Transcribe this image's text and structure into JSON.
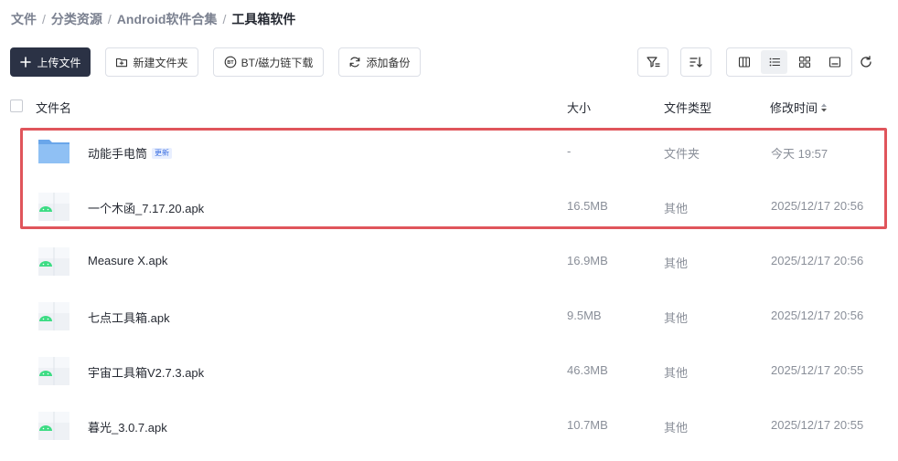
{
  "breadcrumb": {
    "items": [
      "文件",
      "分类资源",
      "Android软件合集",
      "工具箱软件"
    ],
    "separator": "/"
  },
  "toolbar": {
    "upload_label": "上传文件",
    "new_folder_label": "新建文件夹",
    "bt_label": "BT/磁力链下载",
    "backup_label": "添加备份"
  },
  "table": {
    "headers": {
      "name": "文件名",
      "size": "大小",
      "type": "文件类型",
      "modified": "修改时间"
    },
    "rows": [
      {
        "name": "动能手电筒",
        "badge": "更新",
        "size": "-",
        "type": "文件夹",
        "modified": "今天 19:57",
        "kind": "folder"
      },
      {
        "name": "一个木函_7.17.20.apk",
        "size": "16.5MB",
        "type": "其他",
        "modified": "2025/12/17 20:56",
        "kind": "apk"
      },
      {
        "name": "Measure X.apk",
        "size": "16.9MB",
        "type": "其他",
        "modified": "2025/12/17 20:56",
        "kind": "apk"
      },
      {
        "name": "七点工具箱.apk",
        "size": "9.5MB",
        "type": "其他",
        "modified": "2025/12/17 20:56",
        "kind": "apk"
      },
      {
        "name": "宇宙工具箱V2.7.3.apk",
        "size": "46.3MB",
        "type": "其他",
        "modified": "2025/12/17 20:55",
        "kind": "apk"
      },
      {
        "name": "暮光_3.0.7.apk",
        "size": "10.7MB",
        "type": "其他",
        "modified": "2025/12/17 20:55",
        "kind": "apk"
      }
    ]
  },
  "colors": {
    "primary_button": "#2b3245",
    "highlight_border": "#e0555b",
    "folder_icon": "#7fb2ee",
    "android_green": "#3ddc84"
  },
  "icons": {
    "upload": "plus-icon",
    "new_folder": "folder-plus-icon",
    "bt": "bt-icon",
    "backup": "sync-icon",
    "filter": "filter-icon",
    "sort": "sort-icon",
    "refresh": "refresh-icon"
  }
}
